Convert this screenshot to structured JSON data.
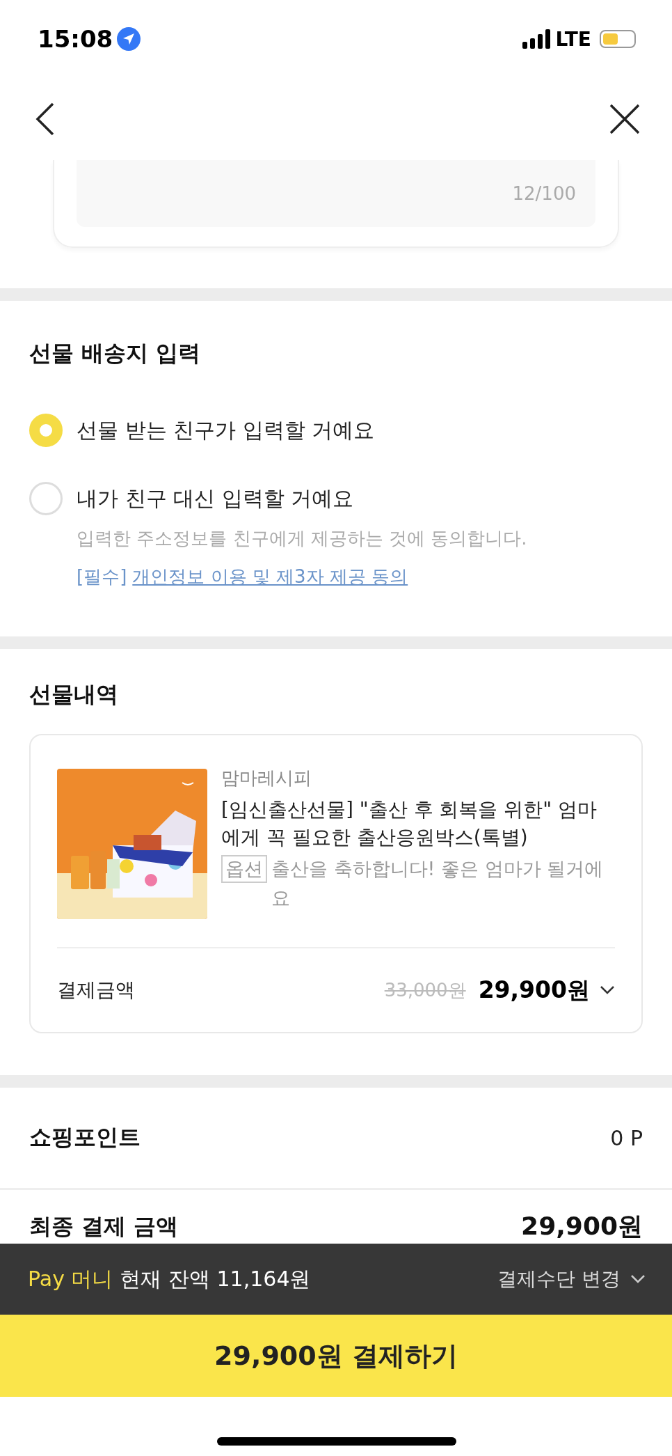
{
  "status_bar": {
    "time": "15:08",
    "network": "LTE"
  },
  "message": {
    "counter": "12/100"
  },
  "delivery": {
    "title": "선물 배송지 입력",
    "options": [
      {
        "label": "선물 받는 친구가 입력할 거예요",
        "selected": true
      },
      {
        "label": "내가 친구 대신 입력할 거예요",
        "selected": false,
        "note": "입력한 주소정보를 친구에게 제공하는 것에 동의합니다.",
        "consent_tag": "[필수]",
        "consent_link": "개인정보 이용 및 제3자 제공 동의"
      }
    ]
  },
  "gift": {
    "title": "선물내역",
    "product": {
      "brand": "맘마레시피",
      "name": "[임신출산선물] \"출산 후 회복을 위한\" 엄마에게 꼭 필요한 출산응원박스(톡별)",
      "option_tag": "옵션",
      "option_text": "출산을 축하합니다! 좋은 엄마가 될거에요",
      "amount_label": "결제금액",
      "original_price": "33,000원",
      "price": "29,900원"
    }
  },
  "points": {
    "label": "쇼핑포인트",
    "value": "0 P"
  },
  "total": {
    "label": "최종 결제 금액",
    "value": "29,900원"
  },
  "pay_bar": {
    "brand": "Pay 머니",
    "balance": "현재 잔액 11,164원",
    "change": "결제수단 변경"
  },
  "pay_button": "29,900원 결제하기"
}
